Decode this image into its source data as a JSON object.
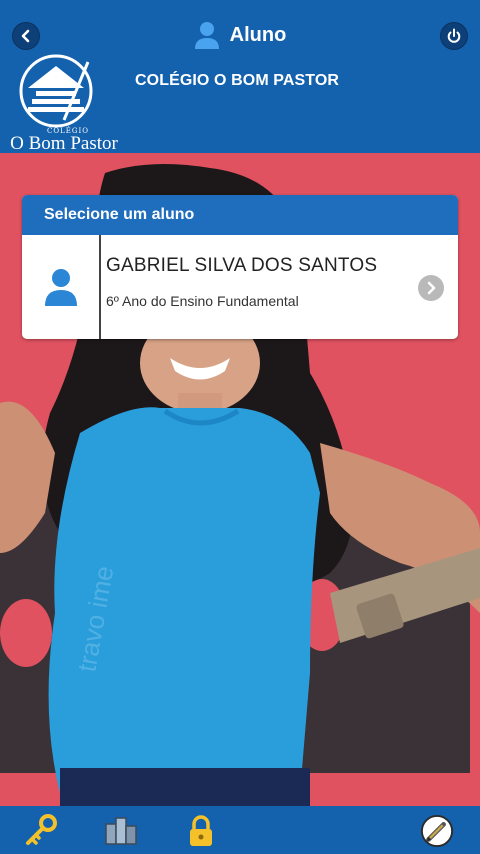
{
  "header": {
    "title": "Aluno",
    "school_name": "COLÉGIO O BOM PASTOR"
  },
  "logo": {
    "line1": "COLÉGIO",
    "line2": "O Bom Pastor"
  },
  "card": {
    "header": "Selecione um aluno",
    "students": [
      {
        "name": "GABRIEL SILVA DOS SANTOS",
        "grade": "6º Ano do Ensino Fundamental"
      }
    ]
  },
  "bottom_nav": {
    "icons": [
      "key-icon",
      "books-icon",
      "lock-icon",
      "pencil-icon"
    ]
  },
  "colors": {
    "header_blue": "#1462ad",
    "card_header_blue": "#1f6dbd",
    "background_pink": "#e05260",
    "shirt_blue": "#2a9ddb"
  }
}
